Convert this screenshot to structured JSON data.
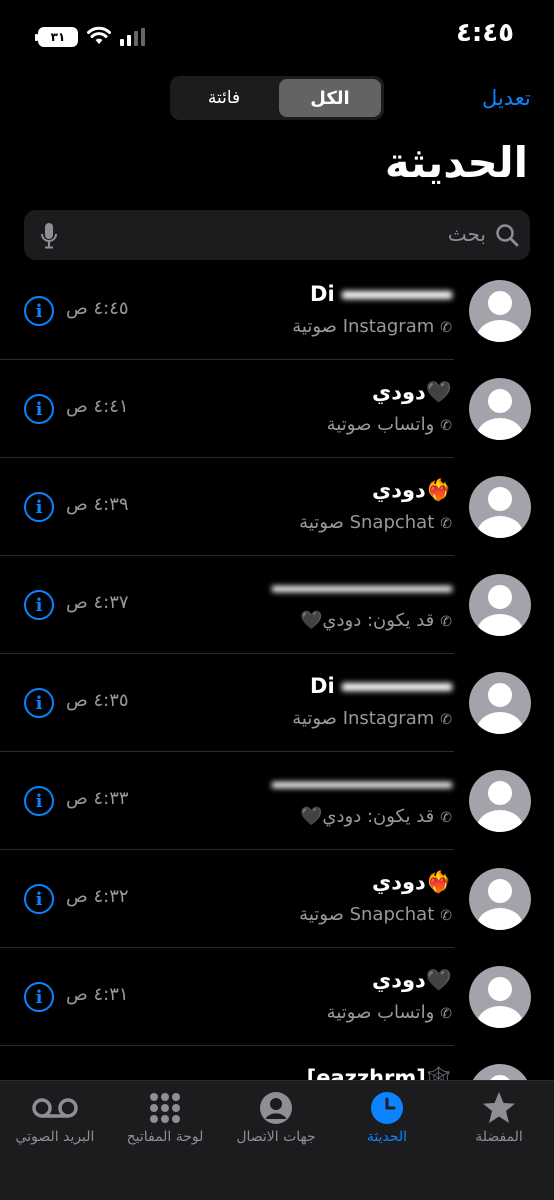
{
  "status_bar": {
    "time": "٤:٤٥",
    "battery": "٣١"
  },
  "header": {
    "edit_label": "تعديل",
    "segment_all": "الكل",
    "segment_missed": "فائتة",
    "title": "الحديثة"
  },
  "search": {
    "placeholder": "بحث"
  },
  "calls": [
    {
      "name_prefix": "Di",
      "name": "[ ]",
      "type": "Instagram صوتية",
      "time": "٤:٤٥ ص"
    },
    {
      "name": "دودي🖤",
      "type": "واتساب صوتية",
      "time": "٤:٤١ ص"
    },
    {
      "name": "دودي❤️‍🔥",
      "type": "Snapchat صوتية",
      "time": "٤:٣٩ ص"
    },
    {
      "name": "",
      "type": "قد يكون: دودي🖤",
      "time": "٤:٣٧ ص"
    },
    {
      "name_prefix": "Di",
      "name": "[ ]",
      "type": "Instagram صوتية",
      "time": "٤:٣٥ ص"
    },
    {
      "name": "",
      "type": "قد يكون: دودي🖤",
      "time": "٤:٣٣ ص"
    },
    {
      "name": "دودي❤️‍🔥",
      "type": "Snapchat صوتية",
      "time": "٤:٣٢ ص"
    },
    {
      "name": "دودي🖤",
      "type": "واتساب صوتية",
      "time": "٤:٣١ ص"
    },
    {
      "name": "[eazzhrm]🕸️",
      "type": "",
      "time": ""
    }
  ],
  "tabs": [
    {
      "label": "المفضلة",
      "icon": "star-icon"
    },
    {
      "label": "الحديثة",
      "icon": "clock-icon",
      "active": true
    },
    {
      "label": "جهات الاتصال",
      "icon": "person-icon"
    },
    {
      "label": "لوحة المفاتيح",
      "icon": "keypad-icon"
    },
    {
      "label": "البريد الصوتي",
      "icon": "voicemail-icon"
    }
  ],
  "colors": {
    "accent": "#0a84ff",
    "background": "#000000",
    "secondary_text": "#98989e"
  }
}
